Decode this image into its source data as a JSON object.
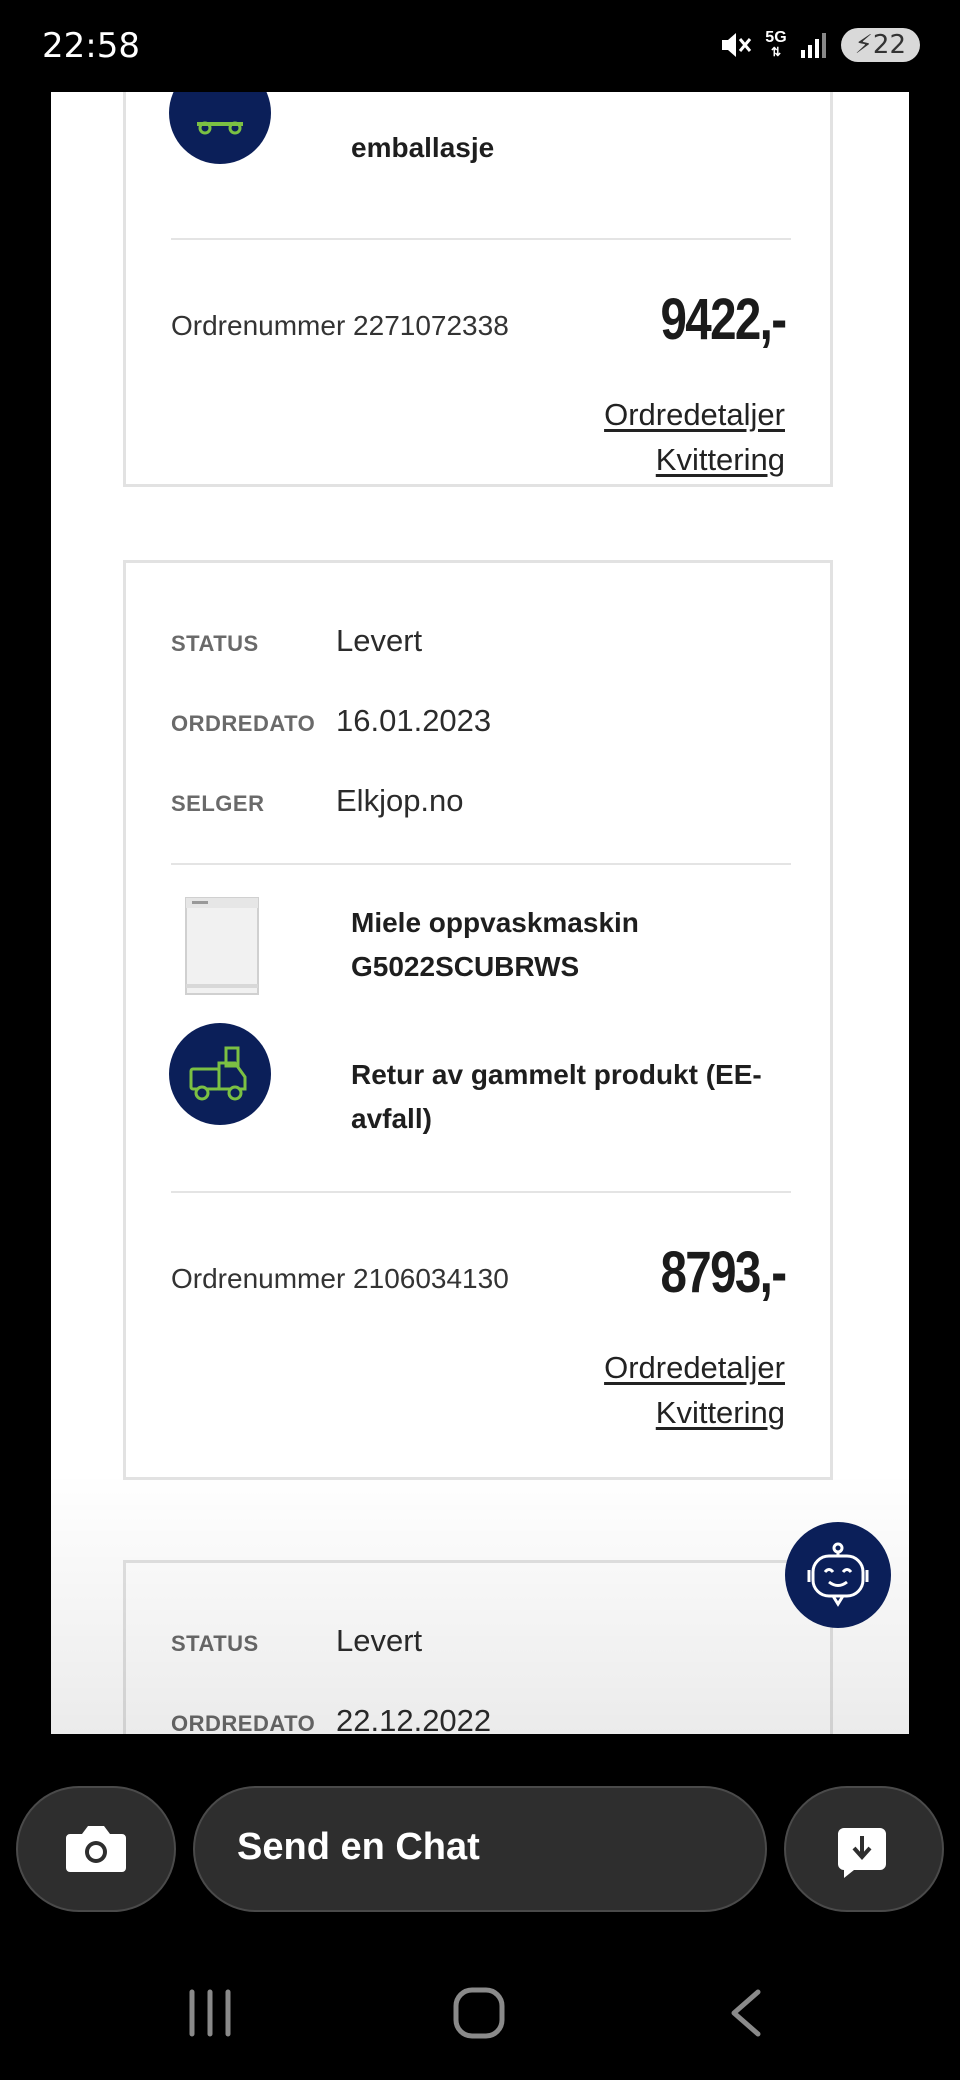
{
  "status_bar": {
    "time": "22:58",
    "network": "5G",
    "battery": "22"
  },
  "cards": [
    {
      "service_text": "emballasje",
      "order_label": "Ordrenummer",
      "order_number": "2271072338",
      "price": "9422,-",
      "links": {
        "details": "Ordredetaljer",
        "receipt": "Kvittering"
      }
    },
    {
      "status_label": "STATUS",
      "status_value": "Levert",
      "date_label": "ORDREDATO",
      "date_value": "16.01.2023",
      "seller_label": "SELGER",
      "seller_value": "Elkjop.no",
      "product_name_line1": "Miele oppvaskmaskin",
      "product_name_line2": "G5022SCUBRWS",
      "service_text": "Retur av gammelt produkt (EE-avfall)",
      "order_label": "Ordrenummer",
      "order_number": "2106034130",
      "price": "8793,-",
      "links": {
        "details": "Ordredetaljer",
        "receipt": "Kvittering"
      }
    },
    {
      "status_label": "STATUS",
      "status_value": "Levert",
      "date_label": "ORDREDATO",
      "date_value": "22.12.2022"
    }
  ],
  "chat_input": {
    "placeholder": "Send en Chat"
  },
  "icons": {
    "camera": "camera-icon",
    "download": "download-icon",
    "truck": "truck-icon",
    "robot": "chatbot-icon",
    "recent_apps": "recent-apps-icon",
    "home": "home-icon",
    "back": "back-icon"
  },
  "colors": {
    "brand_navy": "#0b1f59",
    "icon_green": "#7bc043"
  }
}
